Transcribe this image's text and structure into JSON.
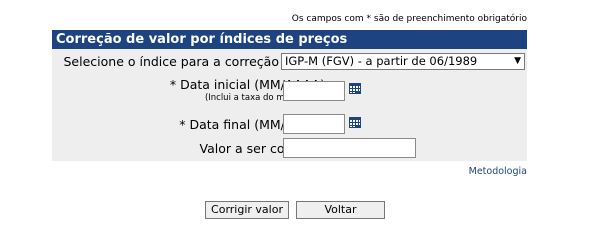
{
  "required_note": "Os campos com * são de preenchimento obrigatório",
  "panel_title": "Correção de valor por índices de preços",
  "form": {
    "index_label": "Selecione o índice para a correção",
    "index_selected": "IGP-M (FGV) - a partir de 06/1989",
    "start_date_label": "* Data inicial (MM/AAAA)",
    "start_date_note": "(Inclui a taxa do mês inicial)",
    "start_date_value": "",
    "end_date_label": "* Data final (MM/AAAA)",
    "end_date_value": "",
    "amount_label": "Valor a ser corrigido",
    "amount_value": ""
  },
  "methodology_link": "Metodologia",
  "buttons": {
    "correct": "Corrigir valor",
    "back": "Voltar"
  },
  "colors": {
    "header_bg": "#1d4480",
    "panel_bg": "#eeeeee",
    "link": "#1d4480"
  },
  "icons": {
    "start_date_picker": "calendar-icon",
    "end_date_picker": "calendar-icon",
    "select_arrow": "dropdown-arrow-icon"
  }
}
